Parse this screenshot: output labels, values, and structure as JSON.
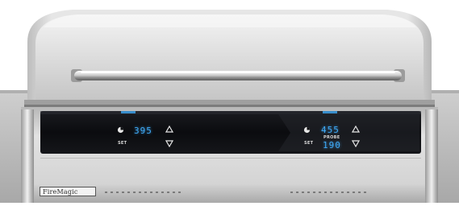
{
  "brand": {
    "logo_text": "FireMagic"
  },
  "left_zone": {
    "temperature": "395",
    "set_label": "SET",
    "timer_icon": "timer-icon",
    "up_icon": "arrow-up-icon",
    "down_icon": "arrow-down-icon"
  },
  "right_zone": {
    "temperature": "455",
    "probe_label": "PROBE",
    "probe_temperature": "190",
    "set_label": "SET",
    "timer_icon": "timer-icon",
    "up_icon": "arrow-up-icon",
    "down_icon": "arrow-down-icon"
  },
  "colors": {
    "display_digits": "#3fa9f5",
    "panel_glass": "#0c0d10",
    "steel_light": "#e9e9e9",
    "steel_dark": "#9a9a9a"
  }
}
